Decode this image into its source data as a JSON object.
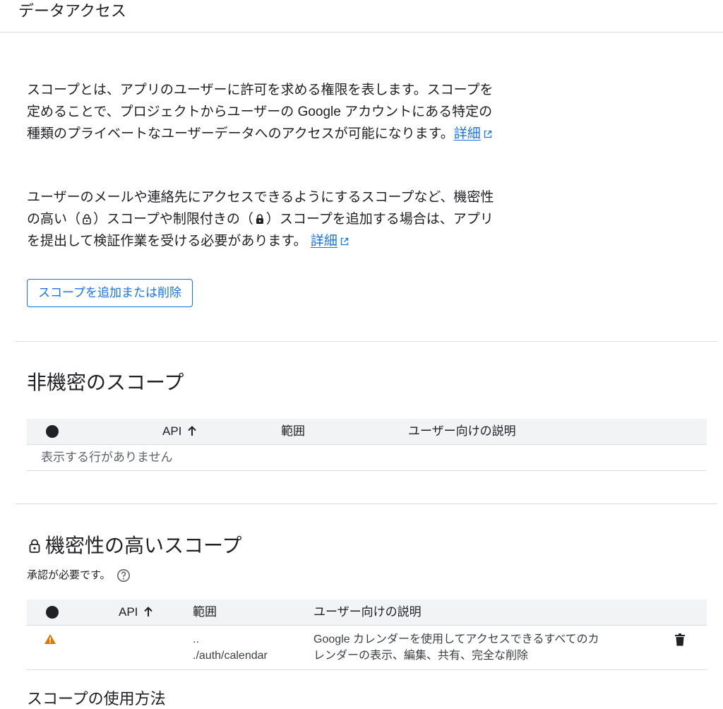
{
  "header": {
    "title": "データアクセス"
  },
  "intro": {
    "para1_text": "スコープとは、アプリのユーザーに許可を求める権限を表します。スコープを定めることで、プロジェクトからユーザーの Google アカウントにある特定の種類のプライベートなユーザーデータへのアクセスが可能になります。",
    "para1_link": "詳細",
    "para2_a": "ユーザーのメールや連絡先にアクセスできるようにするスコープなど、機密性の高い（",
    "para2_b": "）スコープや制限付きの（",
    "para2_c": "）スコープを追加する場合は、アプリを提出して検証作業を受ける必要があります。",
    "para2_link": "詳細"
  },
  "add_button": {
    "label": "スコープを追加または削除"
  },
  "non_sensitive": {
    "title": "非機密のスコープ",
    "columns": {
      "api": "API",
      "scope": "範囲",
      "desc": "ユーザー向けの説明"
    },
    "empty_text": "表示する行がありません"
  },
  "sensitive": {
    "title": "機密性の高いスコープ",
    "subtitle": "承認が必要です。",
    "columns": {
      "api": "API",
      "scope": "範囲",
      "desc": "ユーザー向けの説明"
    },
    "rows": [
      {
        "scope_line1": "..",
        "scope_line2": "./auth/calendar",
        "desc_line1": "Google カレンダーを使用してアクセスできるすべてのカ",
        "desc_line2": "レンダーの表示、編集、共有、完全な削除"
      }
    ]
  },
  "restricted": {
    "title_partial": "スコープの使用方法"
  },
  "colors": {
    "accent": "#1a73e8",
    "warning": "#e37400",
    "text": "#202124",
    "header_bg": "#f1f3f4"
  },
  "icons": [
    "external-link-icon",
    "lock-outline-icon",
    "lock-filled-icon",
    "sort-arrow-up-icon",
    "help-icon",
    "warning-icon",
    "delete-icon"
  ]
}
